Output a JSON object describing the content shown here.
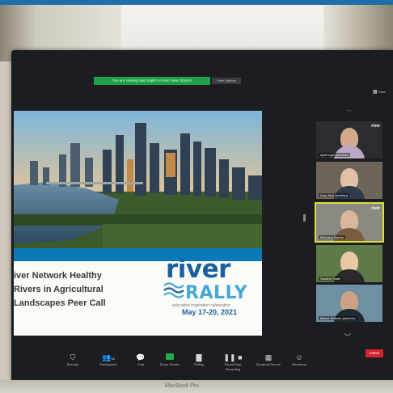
{
  "environment": {
    "laptop_label": "MacBook Pro"
  },
  "notification": {
    "banner_text": "You are viewing April Ingle's screen  View Options",
    "view_options_label": "View Options"
  },
  "header": {
    "view_label": "View"
  },
  "slide": {
    "title": "iver Network Healthy\nRivers in Agricultural\nLandscapes Peer Call",
    "logo_river": "river",
    "logo_rally": "RALLY",
    "tagline": "education  inspiration  celebration",
    "date": "May 17-20, 2021"
  },
  "gallery": {
    "participants": [
      {
        "name": "April Ingle (she/her)",
        "brand": "river"
      },
      {
        "name": "Amy Beal (she/her)",
        "brand": ""
      },
      {
        "name": "Michaela Myrlos",
        "brand": "river"
      },
      {
        "name": "Sandra Postel",
        "brand": ""
      },
      {
        "name": "Marne Hofman (she/her)",
        "brand": ""
      }
    ]
  },
  "toolbar": {
    "security": "Security",
    "participants": "Participants",
    "participants_count": "55",
    "chat": "Chat",
    "share_screen": "Share Screen",
    "polling": "Polling",
    "pause_recording": "Pause/Stop Recording",
    "breakout_rooms": "Breakout Rooms",
    "reactions": "Reactions",
    "leave": "Leave"
  },
  "colors": {
    "accent_green": "#1fa04a",
    "leave_red": "#d3262c",
    "active_speaker": "#d9e03a",
    "brand_blue": "#1a5f9e",
    "brand_light_blue": "#45a8d8"
  }
}
